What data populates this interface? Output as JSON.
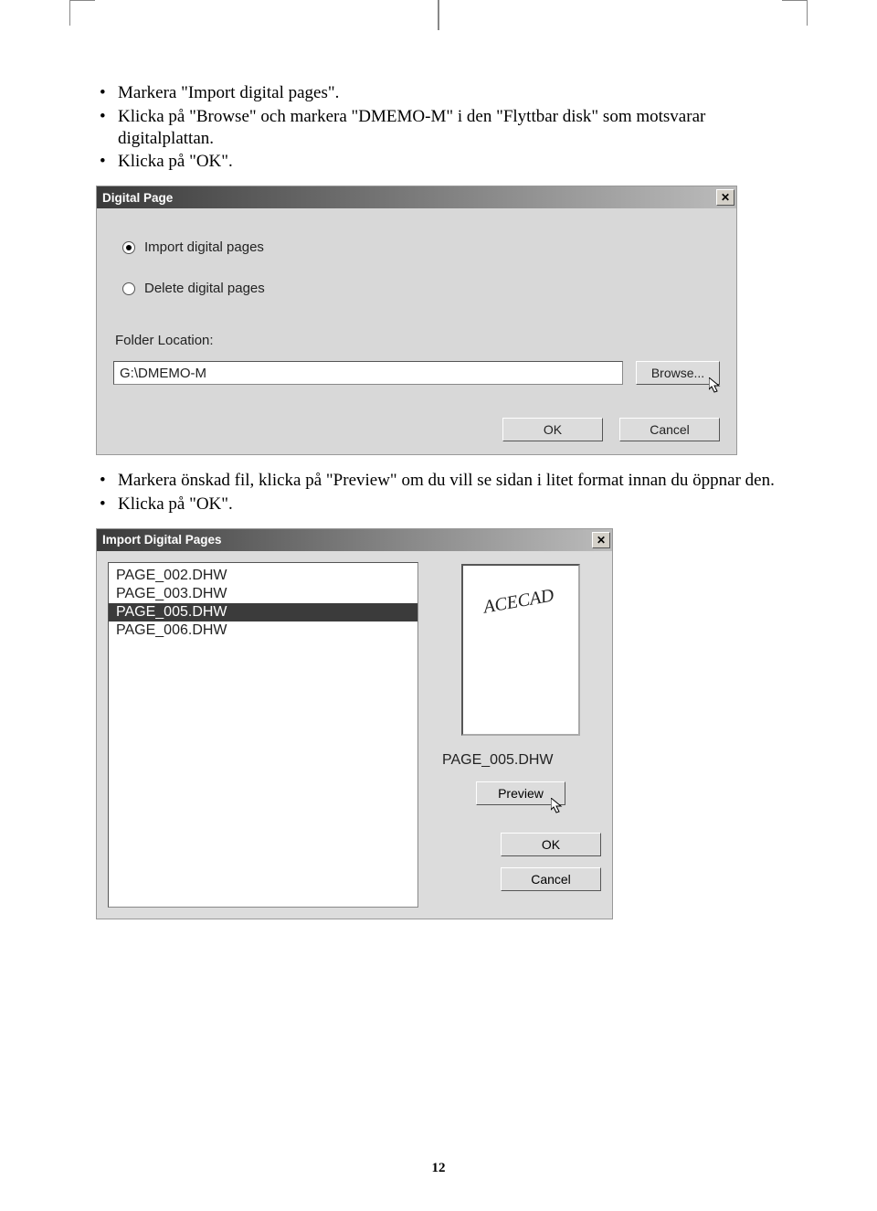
{
  "bullets1": {
    "b1": "Markera \"Import digital pages\".",
    "b2": "Klicka på \"Browse\" och markera \"DMEMO-M\" i den \"Flyttbar disk\" som motsvarar digitalplattan.",
    "b3": "Klicka på \"OK\"."
  },
  "dialog1": {
    "title": "Digital Page",
    "radio_import": "Import digital pages",
    "radio_delete": "Delete digital pages",
    "folder_label": "Folder Location:",
    "path": "G:\\DMEMO-M",
    "browse": "Browse...",
    "ok": "OK",
    "cancel": "Cancel"
  },
  "bullets2": {
    "b1": "Markera önskad fil, klicka på \"Preview\" om du vill se sidan i litet format innan du öppnar den.",
    "b2": "Klicka på \"OK\"."
  },
  "dialog2": {
    "title": "Import Digital Pages",
    "files": {
      "f0": "PAGE_002.DHW",
      "f1": "PAGE_003.DHW",
      "f2": "PAGE_005.DHW",
      "f3": "PAGE_006.DHW"
    },
    "preview_content": "ACECAD",
    "selected_name": "PAGE_005.DHW",
    "preview": "Preview",
    "ok": "OK",
    "cancel": "Cancel"
  },
  "page_number": "12"
}
